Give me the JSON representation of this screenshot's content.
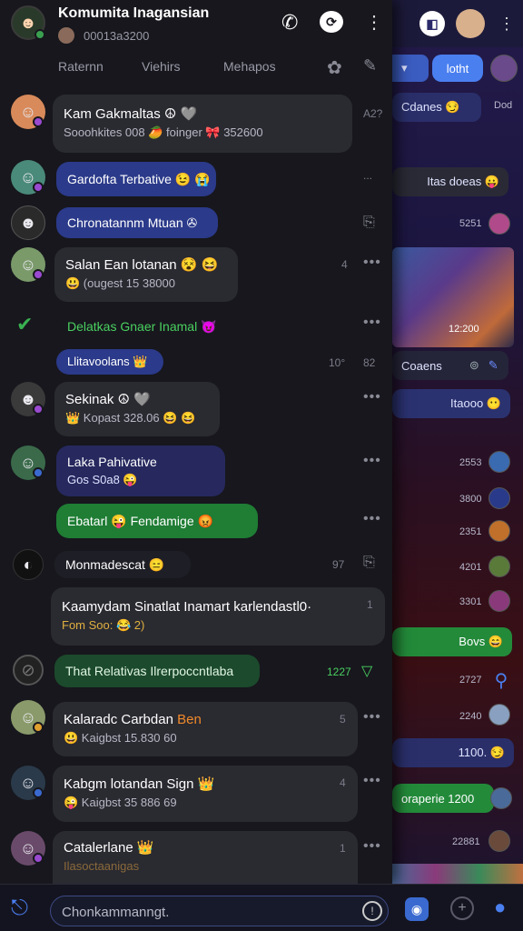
{
  "header": {
    "title": "Komumita Inagansian",
    "subtitle": "00013a3200",
    "call_icon": "phone-icon",
    "video_icon": "video-chat-icon",
    "menu_icon": "more-vertical-icon"
  },
  "tabs": [
    {
      "label": "Raternn"
    },
    {
      "label": "Viehirs"
    },
    {
      "label": "Mehapos"
    }
  ],
  "messages": [
    {
      "title": "Kam Gakmaltas ☮ 🩶",
      "sub": "Sooohkites 008 🥭 foinger 🎀 352600",
      "meta": "A2?"
    },
    {
      "title": "Gardofta Terbative 😉 😭",
      "meta": "..."
    },
    {
      "title": "Chronatannm Mtuan ✇",
      "meta": ""
    },
    {
      "title": "Salan Ean lotanan 😵 😆",
      "sub": "😃 (ougest 15 38000",
      "meta": "4"
    },
    {
      "title": "Delatkas Gnaer Inamal 😈",
      "meta": ""
    },
    {
      "title": "Llitavoolans 👑",
      "meta": "10°",
      "meta2": "82"
    },
    {
      "title": "Sekinak ☮ 🩶",
      "sub": "👑 Kopast 328.06 😆 😆",
      "meta": ""
    },
    {
      "title": "Laka Pahivative",
      "sub": "Gos S0a8 😜",
      "meta": ""
    },
    {
      "title": "Ebatarl 😜 Fendamige 😡",
      "meta": ""
    },
    {
      "title": "Monmadescat 😑",
      "meta": "97"
    },
    {
      "title": "Kaamydam Sinatlat Inamart karlendastl0·",
      "sub": "Fom Soo: 😂  2)",
      "meta": "1"
    },
    {
      "title": "That Relativas Ilrerpoccntlaba",
      "meta": "1227"
    },
    {
      "title": "Kalaradc Carbdan",
      "title_extra": "Ben",
      "sub": "😃 Kaigbst 15.830 60",
      "meta": "5"
    },
    {
      "title": "Kabgm lotandan Sign 👑",
      "sub": "😜 Kaigbst 35 886 69",
      "meta": "4"
    },
    {
      "title": "Catalerlane 👑",
      "sub": "Ilasoctaanigas",
      "meta": "1"
    }
  ],
  "right": {
    "tab_active": "lotht",
    "bubbles": [
      {
        "text": "Cdanes 😏",
        "time": "Dod"
      },
      {
        "text": "Itas doeas 😛"
      },
      {
        "time": "5251"
      },
      {
        "time": "12:200"
      },
      {
        "text": "Coaens"
      },
      {
        "text": "Itaooo 😶"
      },
      {
        "time": "2553"
      },
      {
        "time": "3800"
      },
      {
        "time": "2351"
      },
      {
        "time": "4201"
      },
      {
        "time": "3301"
      },
      {
        "text": "Bovs 😄"
      },
      {
        "time": "2727"
      },
      {
        "time": "2240"
      },
      {
        "text": "1100. 😏"
      },
      {
        "text": "oraperie 1200"
      },
      {
        "time": "22881"
      }
    ]
  },
  "composer": {
    "placeholder": "Chonkammanngt.",
    "attach_icon": "paperclip-icon",
    "info_icon": "info-icon",
    "camera_icon": "camera-icon",
    "add_icon": "add-circle-icon",
    "profile_icon": "person-icon"
  }
}
